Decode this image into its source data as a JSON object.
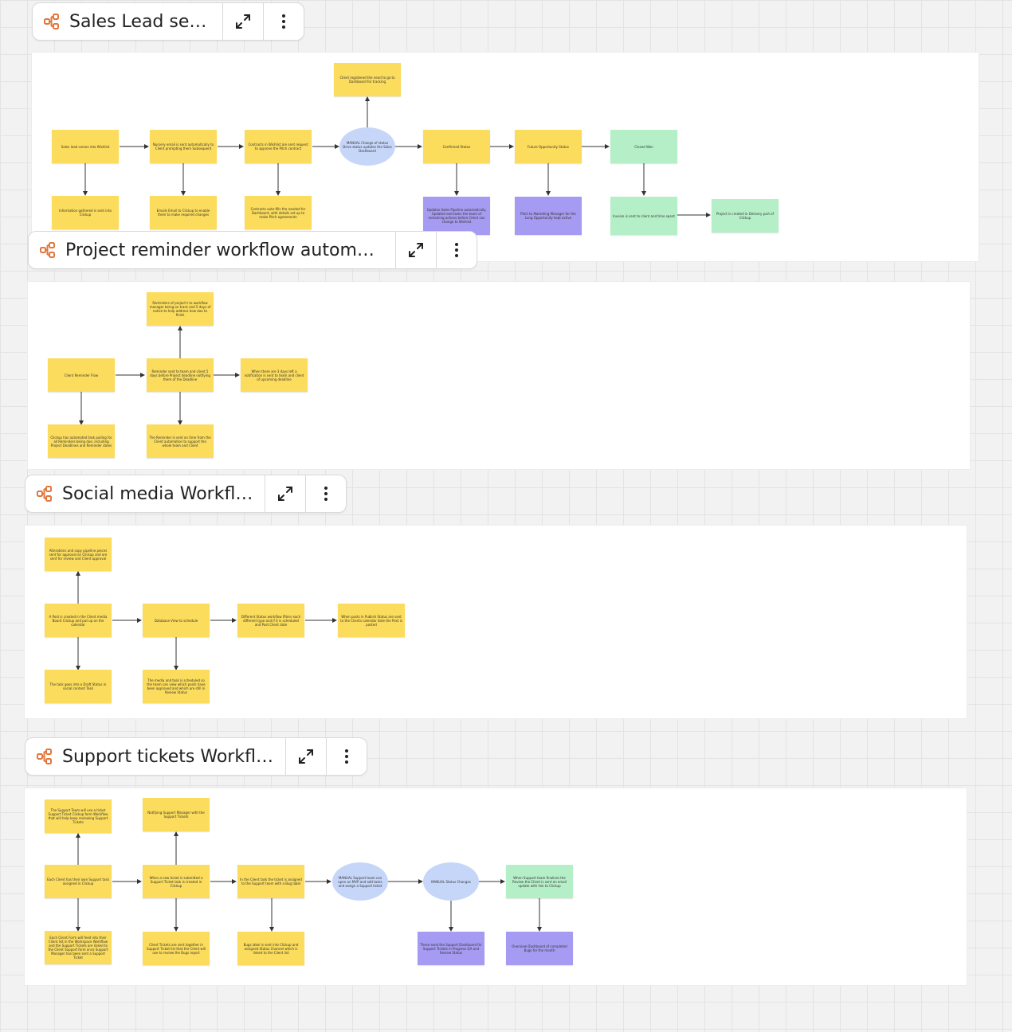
{
  "colors": {
    "sticky_yellow": "#fbdc5c",
    "sticky_purple": "#a59bf2",
    "sticky_green": "#b5efc8",
    "decision_blue": "#c6d6f9",
    "frame_icon_orange": "#e3763b"
  },
  "icons": {
    "frame": "diagram-icon",
    "expand": "expand-icon",
    "menu": "more-vertical-icon"
  },
  "frames": {
    "sales": {
      "title": "Sales Lead setup",
      "nodes": [
        "Client registered the need to go to Dashboard for tracking",
        "Sales lead comes into Wishlist",
        "Nursery email is sent automatically to Client prompting them Subsequent",
        "Contracts in Wishlist are sent request to approve the Pitch contract",
        "MANUAL Change of status Drive status updates the Sales Dashboard",
        "Confirmed Status",
        "Future Opportunity Status",
        "Closed Won",
        "Information gathered is sent into Clickup",
        "Emails Email to Clickup to enable them to make required changes",
        "Contracts auto-fills the needed for Dashboard, with details set up to make Pitch agreements",
        "Updates Sales Pipeline automatically. Updated and tasks the team of remaining actions before Client can change to Wishlist",
        "Pitch to Marketing Manager for the Long Opportunity kept active",
        "Invoice is sent to client and time spent",
        "Project is created in Delivery part of Clickup"
      ]
    },
    "project": {
      "title": "Project reminder workflow automati…",
      "nodes": [
        "Reminders of project's to workflow manager being on track and 5 days of notice to help address how due to finish",
        "Client Reminder Flow",
        "Reminder sent to team and client 5 days before Project deadline notifying them of the Deadline",
        "When there are 3 days left a notification is sent to team and client of upcoming deadline",
        "Clickup has automated task pulling for all Reminders being due, including Project Deadlines and Reminder dates",
        "The Reminder is sent on time from the Client automation to support the whole team and Client"
      ]
    },
    "social": {
      "title": "Social media Workflow",
      "nodes": [
        "Alterations and copy pipeline pieces sent for approval on Clickup and are sent for review and Client approval",
        "A Post is created in the Client media Board Clickup and put up on the calendar",
        "Database View to schedule",
        "Different Status workflow filters each different type and if it is scheduled and Post Client date",
        "When posts in Publish Status are sent to the Clients calendar date the Post is posted",
        "The task goes into a Draft Status in social content Task",
        "The media and task is scheduled so the team can view which posts have been approved and which are still in Review Status"
      ]
    },
    "support": {
      "title": "Support tickets Workflow",
      "nodes": [
        "The Support Team will use a ticket Support Ticket Clickup form Workflow that will help keep reviewing Support Tickets",
        "Notifying Support Manager with the Support Tickets",
        "Each Client has their own Support task assigned in Clickup",
        "When a new ticket is submitted a Support Ticket task is created in Clickup",
        "In the Client task the ticket is assigned to the Support team with a Bug label",
        "MANUAL Support team can open an MVP and add tasks and assign a Support ticket",
        "MANUAL Status Changes",
        "When Support team finalises the Review the Client is sent an email update with link to Clickup",
        "Each Client Form will feed into their Client list in the Workspace Workflow and the Support Tickets are linked to the Client Support form once Support Manager has been sent a Support Ticket",
        "Client Tickets are sent together in Support Ticket list that the Client will use to review the Bugs report",
        "Bugs label is sent into Clickup and assigned Status Channel which is linked to the Client list",
        "These send the Support Dashboard for Support Tickets in Progress QA and Review Status",
        "Overview Dashboard of completed Bugs for the month"
      ]
    }
  }
}
